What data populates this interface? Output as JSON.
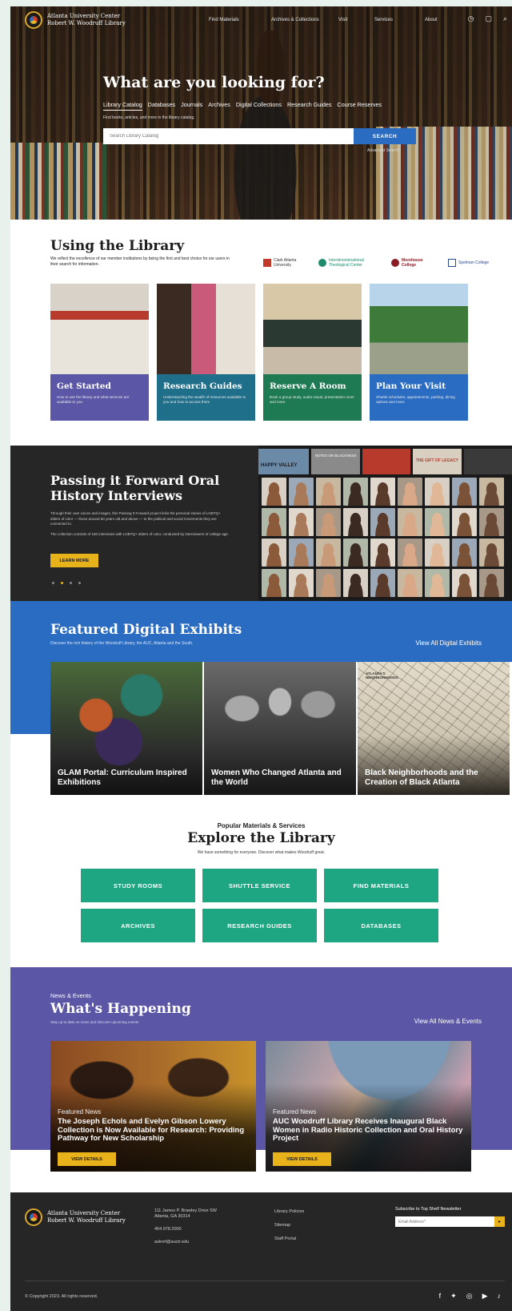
{
  "header": {
    "logo_line1": "Atlanta University Center",
    "logo_line2": "Robert W. Woodruff Library",
    "nav": [
      "Find Materials",
      "Archives & Collections",
      "Visit",
      "Services",
      "About"
    ],
    "icons": [
      "clock-icon",
      "chat-icon",
      "search-icon"
    ]
  },
  "hero": {
    "title": "What are you looking for?",
    "tabs": [
      "Library Catalog",
      "Databases",
      "Journals",
      "Archives",
      "Digital Collections",
      "Research Guides",
      "Course Reserves"
    ],
    "active_tab": "Library Catalog",
    "hint": "Find books, articles, and more in the library catalog.",
    "search_placeholder": "Search Library Catalog",
    "search_button": "SEARCH",
    "advanced": "Advanced Search"
  },
  "using": {
    "title": "Using the Library",
    "desc": "We reflect the excellence of our member institutions by being the first and best choice for our users in their search for information.",
    "partners": [
      "Clark Atlanta University",
      "Interdenominational Theological Center",
      "Morehouse College",
      "Spelman College"
    ],
    "cards": [
      {
        "title": "Get Started",
        "desc": "How to use the library and what services are available to you",
        "color": "#5b57a6"
      },
      {
        "title": "Research Guides",
        "desc": "Understanding the wealth of resources available to you and how to access them",
        "color": "#1f6f8b"
      },
      {
        "title": "Reserve A Room",
        "desc": "Book a group study, audio visual, presentation room and more",
        "color": "#1d7a52"
      },
      {
        "title": "Plan Your Visit",
        "desc": "Shuttle schedules, appointments, parking, dining options and more",
        "color": "#2a6cc2"
      }
    ]
  },
  "oral": {
    "title": "Passing it Forward Oral History Interviews",
    "desc1": "Through their own voices and images, this Passing It Forward project links the personal stories of LGBTQ+ elders of color — those around 50 years old and above — to the political and social movements they are connected to.",
    "desc2": "The collection consists of 150 interviews with LGBTQ+ elders of color, conducted by interviewers of college age.",
    "button": "LEARN MORE",
    "posters": [
      "HAPPY VALLEY",
      "NOTES ON BLACKNESS",
      "THE GIFT OF LEGACY"
    ]
  },
  "featured": {
    "title": "Featured Digital Exhibits",
    "desc": "Discover the rich history of the Woodruff Library, the AUC, Atlanta and the South.",
    "link": "View All Digital Exhibits",
    "exhibits": [
      {
        "title": "GLAM Portal: Curriculum Inspired Exhibitions"
      },
      {
        "title": "Women Who Changed Atlanta and the World"
      },
      {
        "title": "Black Neighborhoods and the Creation of Black Atlanta"
      }
    ],
    "map_label1": "ATLANTA'S",
    "map_label2": "NEIGHBORHOODS"
  },
  "explore": {
    "kicker": "Popular Materials & Services",
    "title": "Explore the Library",
    "desc": "We have something for everyone. Discover what makes Woodruff great.",
    "buttons": [
      "STUDY ROOMS",
      "SHUTTLE SERVICE",
      "FIND MATERIALS",
      "ARCHIVES",
      "RESEARCH GUIDES",
      "DATABASES"
    ]
  },
  "happening": {
    "kicker": "News & Events",
    "title": "What's Happening",
    "desc": "Stay up to date on news and discover upcoming events",
    "link": "View All News & Events",
    "news": [
      {
        "kicker": "Featured News",
        "title": "The Joseph Echols and Evelyn Gibson Lowery Collection is Now Available for Research: Providing Pathway for New Scholarship",
        "button": "VIEW DETAILS"
      },
      {
        "kicker": "Featured News",
        "title": "AUC Woodruff Library Receives Inaugural Black Women in Radio Historic Collection and Oral History Project",
        "button": "VIEW DETAILS"
      }
    ]
  },
  "footer": {
    "address1": "111 James P. Brawley Drive SW",
    "address2": "Atlanta, GA 30314",
    "phone": "404.978.2000",
    "email": "askref@auctr.edu",
    "links": [
      "Library Policies",
      "Sitemap",
      "Staff Portal"
    ],
    "subscribe_label": "Subscribe to Top Shelf Newsletter",
    "email_placeholder": "Email Address*",
    "copyright": "© Copyright 2023. All rights reserved.",
    "social": [
      "facebook-icon",
      "twitter-icon",
      "instagram-icon",
      "youtube-icon",
      "bell-icon"
    ]
  },
  "colors": {
    "blue": "#2a6cc2",
    "green": "#1ea682",
    "purple": "#5b57a6",
    "gold": "#e8b21a",
    "dark": "#262626"
  }
}
